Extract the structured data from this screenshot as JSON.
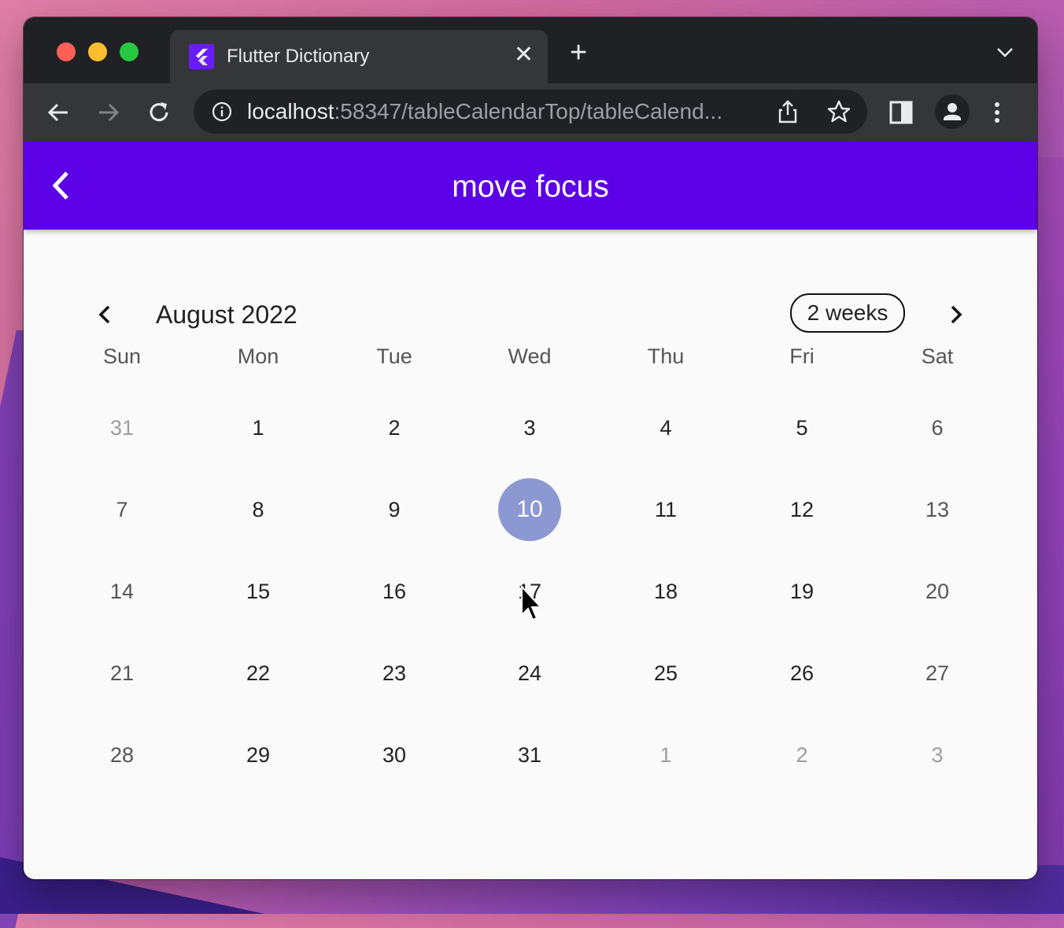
{
  "browser": {
    "tab_title": "Flutter Dictionary",
    "url_host": "localhost",
    "url_rest": ":58347/tableCalendarTop/tableCalend..."
  },
  "app": {
    "title": "move focus"
  },
  "calendar": {
    "month_title": "August 2022",
    "format_button": "2 weeks",
    "weekdays": [
      "Sun",
      "Mon",
      "Tue",
      "Wed",
      "Thu",
      "Fri",
      "Sat"
    ],
    "weeks": [
      [
        "31",
        "1",
        "2",
        "3",
        "4",
        "5",
        "6"
      ],
      [
        "7",
        "8",
        "9",
        "10",
        "11",
        "12",
        "13"
      ],
      [
        "14",
        "15",
        "16",
        "17",
        "18",
        "19",
        "20"
      ],
      [
        "21",
        "22",
        "23",
        "24",
        "25",
        "26",
        "27"
      ],
      [
        "28",
        "29",
        "30",
        "31",
        "1",
        "2",
        "3"
      ]
    ],
    "selected_day": "10",
    "accent_color": "#5c00e6",
    "selected_color": "#8c98d2"
  }
}
